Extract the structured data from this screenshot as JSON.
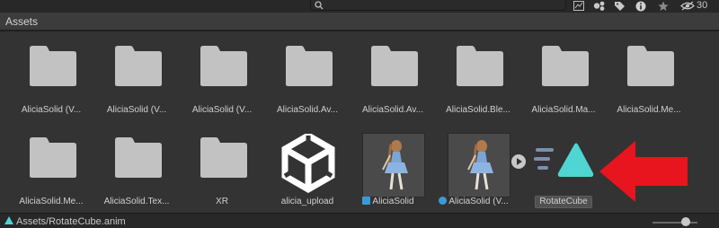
{
  "toolbar": {
    "search_placeholder": "",
    "hidden_count": "30"
  },
  "header": {
    "title": "Assets"
  },
  "assets": [
    {
      "name": "AliciaSolid (V...",
      "kind": "folder"
    },
    {
      "name": "AliciaSolid (V...",
      "kind": "folder"
    },
    {
      "name": "AliciaSolid (V...",
      "kind": "folder"
    },
    {
      "name": "AliciaSolid.Av...",
      "kind": "folder"
    },
    {
      "name": "AliciaSolid.Av...",
      "kind": "folder"
    },
    {
      "name": "AliciaSolid.Ble...",
      "kind": "folder"
    },
    {
      "name": "AliciaSolid.Ma...",
      "kind": "folder"
    },
    {
      "name": "AliciaSolid.Me...",
      "kind": "folder"
    },
    {
      "name": "AliciaSolid.Me...",
      "kind": "folder"
    },
    {
      "name": "AliciaSolid.Tex...",
      "kind": "folder"
    },
    {
      "name": "XR",
      "kind": "folder"
    },
    {
      "name": "alicia_upload",
      "kind": "unity-package"
    },
    {
      "name": "AliciaSolid",
      "kind": "prefab"
    },
    {
      "name": "AliciaSolid (V...",
      "kind": "model"
    },
    {
      "name": "RotateCube",
      "kind": "animation-clip"
    }
  ],
  "status": {
    "path": "Assets/RotateCube.anim"
  },
  "colors": {
    "folder": "#c2c2c2",
    "anim_icon": "#4fd6d2",
    "arrow": "#e8141e",
    "panel_bg": "#333333"
  }
}
